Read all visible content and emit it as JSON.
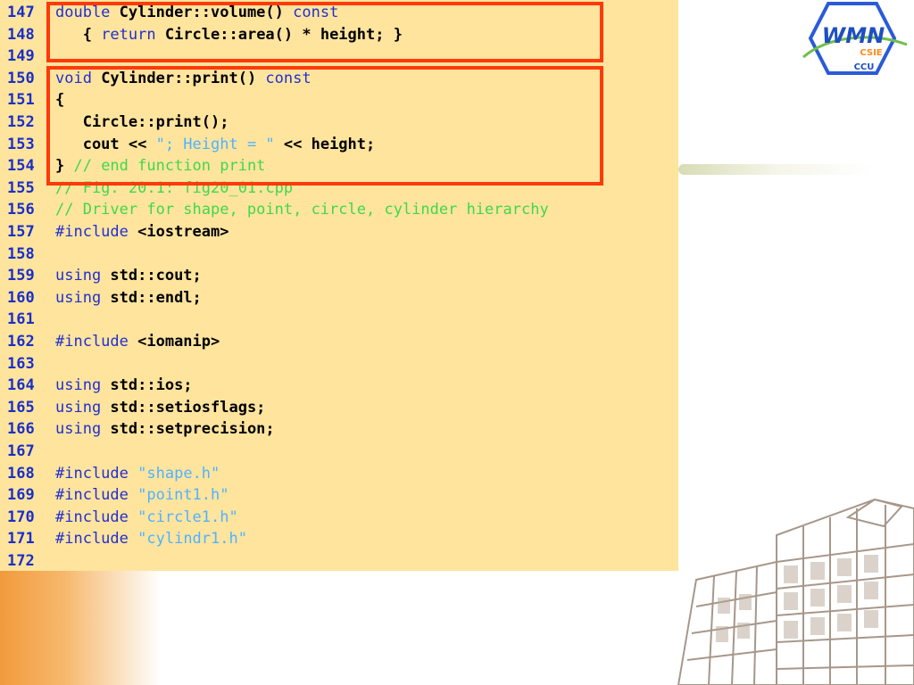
{
  "logo": {
    "main_text": "WMN",
    "sub_text": "CSIE",
    "bottom_text": "CCU"
  },
  "colors": {
    "panel": "#ffe49e",
    "keyword": "#2030d0",
    "string": "#4fb3ff",
    "comment": "#3fd84a",
    "line_number": "#1a2fc8",
    "highlight_box": "#ff3a0a"
  },
  "lines": [
    {
      "num": "147",
      "parts": [
        {
          "t": "double",
          "c": "kw"
        },
        {
          "t": " Cylinder::volume() ",
          "c": ""
        },
        {
          "t": "const",
          "c": "kw"
        }
      ]
    },
    {
      "num": "148",
      "parts": [
        {
          "t": "   { ",
          "c": ""
        },
        {
          "t": "return",
          "c": "kw"
        },
        {
          "t": " Circle::area() * height; }",
          "c": ""
        }
      ]
    },
    {
      "num": "149",
      "parts": []
    },
    {
      "num": "150",
      "parts": [
        {
          "t": "void",
          "c": "kw"
        },
        {
          "t": " Cylinder::print() ",
          "c": ""
        },
        {
          "t": "const",
          "c": "kw"
        }
      ]
    },
    {
      "num": "151",
      "parts": [
        {
          "t": "{",
          "c": ""
        }
      ]
    },
    {
      "num": "152",
      "parts": [
        {
          "t": "   Circle::print();",
          "c": ""
        }
      ]
    },
    {
      "num": "153",
      "parts": [
        {
          "t": "   cout << ",
          "c": ""
        },
        {
          "t": "\"; Height = \"",
          "c": "str"
        },
        {
          "t": " << height;",
          "c": ""
        }
      ]
    },
    {
      "num": "154",
      "parts": [
        {
          "t": "} ",
          "c": ""
        },
        {
          "t": "// end function print",
          "c": "cm"
        }
      ]
    },
    {
      "num": "155",
      "parts": [
        {
          "t": "// Fig. 20.1: fig20_01.cpp",
          "c": "cm"
        }
      ]
    },
    {
      "num": "156",
      "parts": [
        {
          "t": "// Driver for shape, point, circle, cylinder hierarchy",
          "c": "cm"
        }
      ]
    },
    {
      "num": "157",
      "parts": [
        {
          "t": "#include",
          "c": "kw"
        },
        {
          "t": " <iostream>",
          "c": ""
        }
      ]
    },
    {
      "num": "158",
      "parts": []
    },
    {
      "num": "159",
      "parts": [
        {
          "t": "using",
          "c": "kw"
        },
        {
          "t": " std::cout;",
          "c": ""
        }
      ]
    },
    {
      "num": "160",
      "parts": [
        {
          "t": "using",
          "c": "kw"
        },
        {
          "t": " std::endl;",
          "c": ""
        }
      ]
    },
    {
      "num": "161",
      "parts": []
    },
    {
      "num": "162",
      "parts": [
        {
          "t": "#include",
          "c": "kw"
        },
        {
          "t": " <iomanip>",
          "c": ""
        }
      ]
    },
    {
      "num": "163",
      "parts": []
    },
    {
      "num": "164",
      "parts": [
        {
          "t": "using",
          "c": "kw"
        },
        {
          "t": " std::ios;",
          "c": ""
        }
      ]
    },
    {
      "num": "165",
      "parts": [
        {
          "t": "using",
          "c": "kw"
        },
        {
          "t": " std::setiosflags;",
          "c": ""
        }
      ]
    },
    {
      "num": "166",
      "parts": [
        {
          "t": "using",
          "c": "kw"
        },
        {
          "t": " std::setprecision;",
          "c": ""
        }
      ]
    },
    {
      "num": "167",
      "parts": []
    },
    {
      "num": "168",
      "parts": [
        {
          "t": "#include",
          "c": "kw"
        },
        {
          "t": " ",
          "c": ""
        },
        {
          "t": "\"shape.h\"",
          "c": "str"
        }
      ]
    },
    {
      "num": "169",
      "parts": [
        {
          "t": "#include",
          "c": "kw"
        },
        {
          "t": " ",
          "c": ""
        },
        {
          "t": "\"point1.h\"",
          "c": "str"
        }
      ]
    },
    {
      "num": "170",
      "parts": [
        {
          "t": "#include",
          "c": "kw"
        },
        {
          "t": " ",
          "c": ""
        },
        {
          "t": "\"circle1.h\"",
          "c": "str"
        }
      ]
    },
    {
      "num": "171",
      "parts": [
        {
          "t": "#include",
          "c": "kw"
        },
        {
          "t": " ",
          "c": ""
        },
        {
          "t": "\"cylindr1.h\"",
          "c": "str"
        }
      ]
    },
    {
      "num": "172",
      "parts": []
    }
  ]
}
